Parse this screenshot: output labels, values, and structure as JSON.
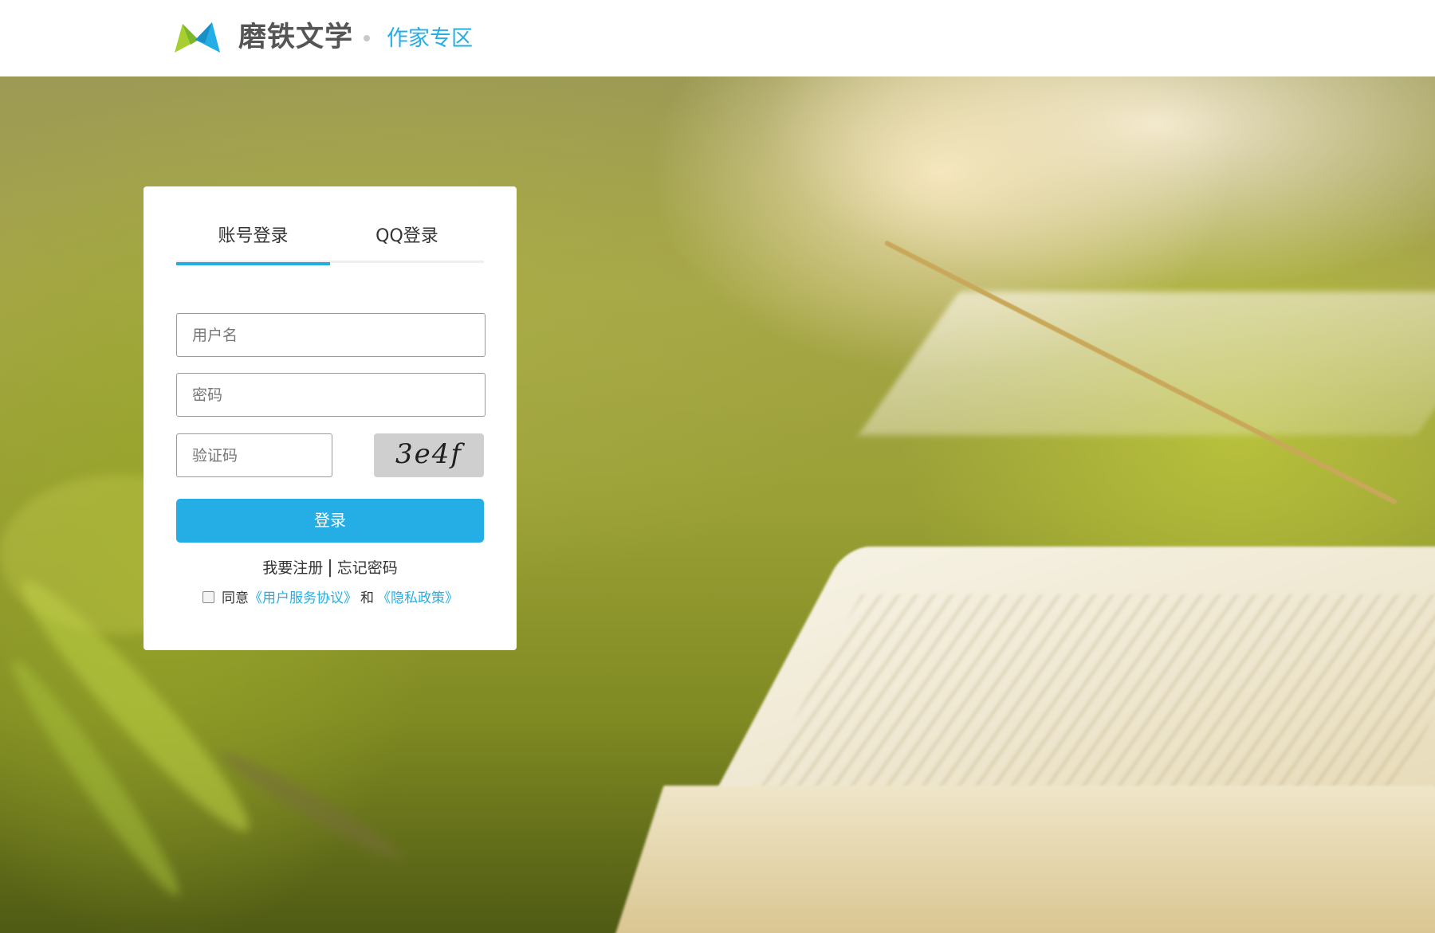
{
  "header": {
    "brand_name": "磨铁文学",
    "section_name": "作家专区"
  },
  "login": {
    "tabs": [
      {
        "label": "账号登录",
        "active": true
      },
      {
        "label": "QQ登录",
        "active": false
      }
    ],
    "username": {
      "placeholder": "用户名",
      "value": ""
    },
    "password": {
      "placeholder": "密码",
      "value": ""
    },
    "captcha": {
      "placeholder": "验证码",
      "value": "",
      "image_text": "3e4f"
    },
    "submit_label": "登录",
    "register_label": "我要注册",
    "separator": "|",
    "forgot_label": "忘记密码",
    "agree": {
      "checked": false,
      "prefix": "同意",
      "terms_label": "《用户服务协议》",
      "and": "和",
      "privacy_label": "《隐私政策》"
    }
  },
  "colors": {
    "accent": "#25aee6",
    "logo_green": "#a6cf2f",
    "logo_blue": "#25aee6"
  }
}
